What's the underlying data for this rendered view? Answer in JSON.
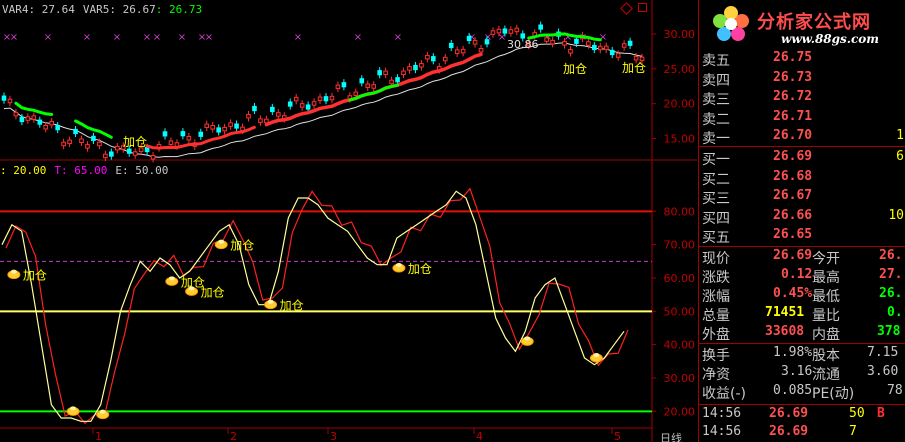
{
  "header": {
    "var4_label": "VAR4: 27.64",
    "var5_label": "VAR5: 26.67",
    "ma_label": ": 26.73"
  },
  "kdj_header": {
    "d_label": ": 20.00",
    "t_label": "T: 65.00",
    "e_label": "E: 50.00"
  },
  "price_axis": [
    "30.00",
    "25.00",
    "20.00",
    "15.00"
  ],
  "osc_axis": [
    "80.00",
    "70.00",
    "60.00",
    "50.00",
    "40.00",
    "30.00",
    "20.00"
  ],
  "month_labels": [
    "1",
    "2",
    "3",
    "4",
    "5"
  ],
  "annotations": {
    "add_label": "加仓",
    "high_label": "30.86"
  },
  "pane_title": "日线",
  "logo": {
    "brand": "分析家公式网",
    "url": "www.88gs.com"
  },
  "quote": {
    "asks": [
      {
        "label": "卖五",
        "price": "26.75",
        "vol": ""
      },
      {
        "label": "卖四",
        "price": "26.73",
        "vol": ""
      },
      {
        "label": "卖三",
        "price": "26.72",
        "vol": ""
      },
      {
        "label": "卖二",
        "price": "26.71",
        "vol": ""
      },
      {
        "label": "卖一",
        "price": "26.70",
        "vol": "1"
      }
    ],
    "bids": [
      {
        "label": "买一",
        "price": "26.69",
        "vol": "6"
      },
      {
        "label": "买二",
        "price": "26.68",
        "vol": ""
      },
      {
        "label": "买三",
        "price": "26.67",
        "vol": ""
      },
      {
        "label": "买四",
        "price": "26.66",
        "vol": "10"
      },
      {
        "label": "买五",
        "price": "26.65",
        "vol": ""
      }
    ],
    "stats": {
      "last_label": "现价",
      "last": "26.69",
      "open_label": "今开",
      "open": "26.",
      "change_label": "涨跌",
      "change": "0.12",
      "high_label": "最高",
      "high": "27.",
      "pct_label": "涨幅",
      "pct": "0.45%",
      "low_label": "最低",
      "low": "26.",
      "volume_label": "总量",
      "volume": "71451",
      "ratio_label": "量比",
      "ratio": "0.",
      "outer_label": "外盘",
      "outer": "33608",
      "inner_label": "内盘",
      "inner": "378"
    },
    "fund": {
      "turnover_label": "换手",
      "turnover": "1.98%",
      "shares_label": "股本",
      "shares": "7.15",
      "nav_label": "净资",
      "nav": "3.16",
      "float_label": "流通",
      "float": "3.60",
      "eps_label": "收益(-)",
      "eps": "0.085",
      "pe_label": "PE(动)",
      "pe": "78"
    },
    "ticks": [
      {
        "time": "14:56",
        "price": "26.69",
        "vol": "50",
        "side": "B"
      },
      {
        "time": "14:56",
        "price": "26.69",
        "vol": "7",
        "side": ""
      }
    ]
  },
  "colors": {
    "up": "#ff3030",
    "down": "#00ffff",
    "k_line": "#ffff99",
    "d_line": "#ff2020",
    "ref_red": "#e01010",
    "ref_yellow": "#ffff66",
    "ref_green": "#00ff00",
    "ref_purple": "#c040c0"
  },
  "chart_data": {
    "type": "line",
    "price_range": [
      12.5,
      32
    ],
    "oscillator_range": [
      15,
      90
    ],
    "reference_lines": [
      80,
      65,
      50,
      20
    ],
    "k_series": [
      70,
      76,
      74,
      58,
      40,
      22,
      18,
      18,
      17,
      17,
      22,
      35,
      50,
      58,
      65,
      62,
      66,
      64,
      60,
      62,
      66,
      70,
      74,
      76,
      70,
      58,
      52,
      52,
      62,
      78,
      84,
      84,
      82,
      78,
      76,
      74,
      70,
      66,
      64,
      64,
      72,
      74,
      76,
      78,
      80,
      82,
      86,
      84,
      76,
      62,
      48,
      42,
      38,
      44,
      54,
      58,
      60,
      52,
      44,
      36,
      34,
      36,
      40,
      44
    ]
  }
}
